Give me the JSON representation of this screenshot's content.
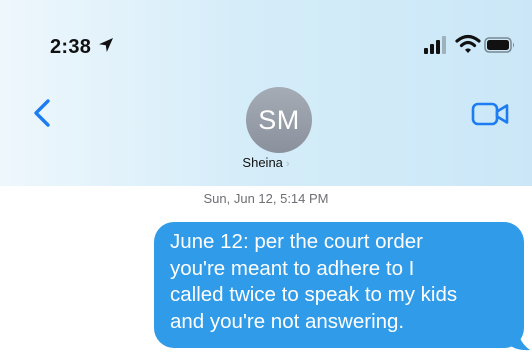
{
  "status_bar": {
    "time": "2:38",
    "icons": [
      "location-arrow-icon",
      "cellular-signal-icon",
      "wifi-icon",
      "battery-icon"
    ]
  },
  "nav": {
    "back_icon": "chevron-left-icon",
    "video_icon": "video-camera-icon",
    "accent_color": "#1d7cf2"
  },
  "contact": {
    "initials": "SM",
    "name": "Sheina",
    "chevron": "›"
  },
  "conversation": {
    "timestamp": "Sun, Jun 12, 5:14 PM",
    "messages": [
      {
        "direction": "outgoing",
        "color": "#2f9be9",
        "text": "June 12: per the court order\nyou're meant to adhere to I\ncalled twice to speak to my kids\nand you're not answering."
      }
    ]
  }
}
